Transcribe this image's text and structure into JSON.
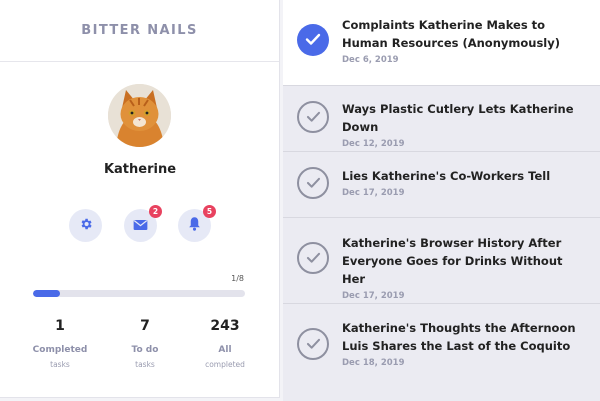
{
  "brand": "BITTER NAILS",
  "user": {
    "name": "Katherine"
  },
  "icons": {
    "settings": {
      "name": "gear-icon"
    },
    "messages": {
      "name": "envelope-icon",
      "badge": "2"
    },
    "notifications": {
      "name": "bell-icon",
      "badge": "5"
    }
  },
  "progress": {
    "label": "1/8",
    "fraction": 0.125
  },
  "stats": [
    {
      "value": "1",
      "label": "Completed",
      "sub": "tasks"
    },
    {
      "value": "7",
      "label": "To do",
      "sub": "tasks"
    },
    {
      "value": "243",
      "label": "All",
      "sub": "completed"
    }
  ],
  "tasks": [
    {
      "title": "Complaints Katherine Makes to Human Resources (Anonymously)",
      "date": "Dec 6, 2019",
      "state": "checked"
    },
    {
      "title": "Ways Plastic Cutlery Lets Katherine Down",
      "date": "Dec 12, 2019",
      "state": "open"
    },
    {
      "title": "Lies Katherine's Co-Workers Tell",
      "date": "Dec 17, 2019",
      "state": "open"
    },
    {
      "title": "Katherine's Browser History After Everyone Goes for Drinks Without Her",
      "date": "Dec 17, 2019",
      "state": "open"
    },
    {
      "title": "Katherine's Thoughts the Afternoon Luis Shares the Last of the Coquito",
      "date": "Dec 18, 2019",
      "state": "open"
    }
  ],
  "colors": {
    "accent": "#4a6ae8",
    "badge": "#e8425f",
    "muted": "#8e90aa"
  }
}
